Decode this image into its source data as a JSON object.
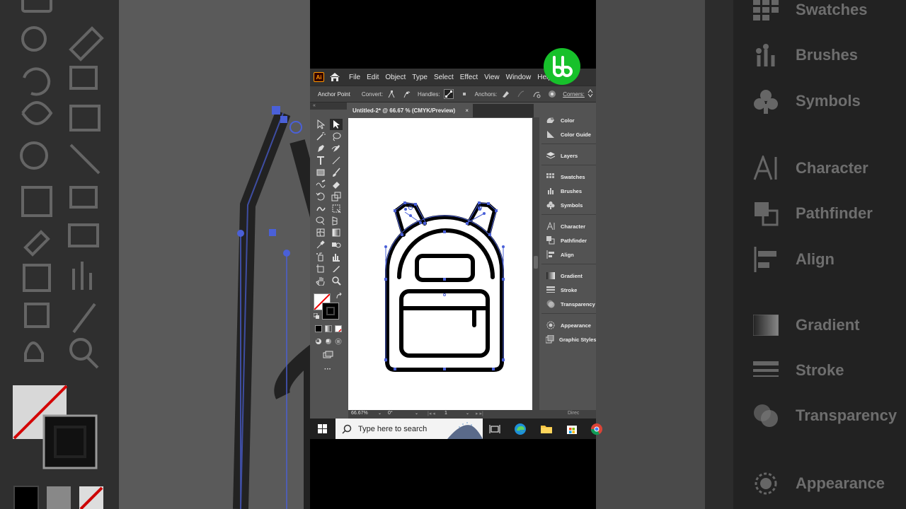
{
  "colors": {
    "accent": "#4a60d8",
    "artwork_stroke": "#000000",
    "brand_green": "#17c12b",
    "ai_orange": "#ff9a00"
  },
  "menubar": {
    "items": [
      "File",
      "Edit",
      "Object",
      "Type",
      "Select",
      "Effect",
      "View",
      "Window",
      "Help"
    ]
  },
  "control_bar": {
    "selection": "Anchor Point",
    "convert_label": "Convert:",
    "handles_label": "Handles:",
    "anchors_label": "Anchors:",
    "corners_label": "Corners:"
  },
  "document_tab": {
    "title": "Untitled-2* @ 66.67 % (CMYK/Preview)",
    "close_glyph": "×"
  },
  "status_bar": {
    "zoom": "66.67%",
    "rotation": "0°",
    "artboard_number": "1",
    "tool_name": "Direc"
  },
  "panels": {
    "groups": [
      [
        "Color",
        "Color Guide"
      ],
      [
        "Layers"
      ],
      [
        "Swatches",
        "Brushes",
        "Symbols"
      ],
      [
        "Character",
        "Pathfinder",
        "Align"
      ],
      [
        "Gradient",
        "Stroke",
        "Transparency"
      ],
      [
        "Appearance",
        "Graphic Styles"
      ]
    ]
  },
  "backdrop_panels": {
    "items": [
      "Swatches",
      "Brushes",
      "Symbols",
      "Character",
      "Pathfinder",
      "Align",
      "Gradient",
      "Stroke",
      "Transparency",
      "Appearance"
    ]
  },
  "taskbar": {
    "search_placeholder": "Type here to search"
  },
  "icons": {
    "toolbar": [
      "direct-selection-icon",
      "selection-icon",
      "magic-wand-icon",
      "lasso-icon",
      "pen-icon",
      "curvature-icon",
      "type-icon",
      "line-icon",
      "rectangle-icon",
      "paintbrush-icon",
      "shaper-icon",
      "eraser-icon",
      "rotate-icon",
      "scale-icon",
      "warp-icon",
      "free-transform-icon",
      "shape-builder-icon",
      "perspective-grid-icon",
      "mesh-icon",
      "gradient-icon",
      "eyedropper-icon",
      "blend-icon",
      "symbol-sprayer-icon",
      "column-graph-icon",
      "artboard-icon",
      "slice-icon",
      "hand-icon",
      "zoom-icon"
    ]
  }
}
